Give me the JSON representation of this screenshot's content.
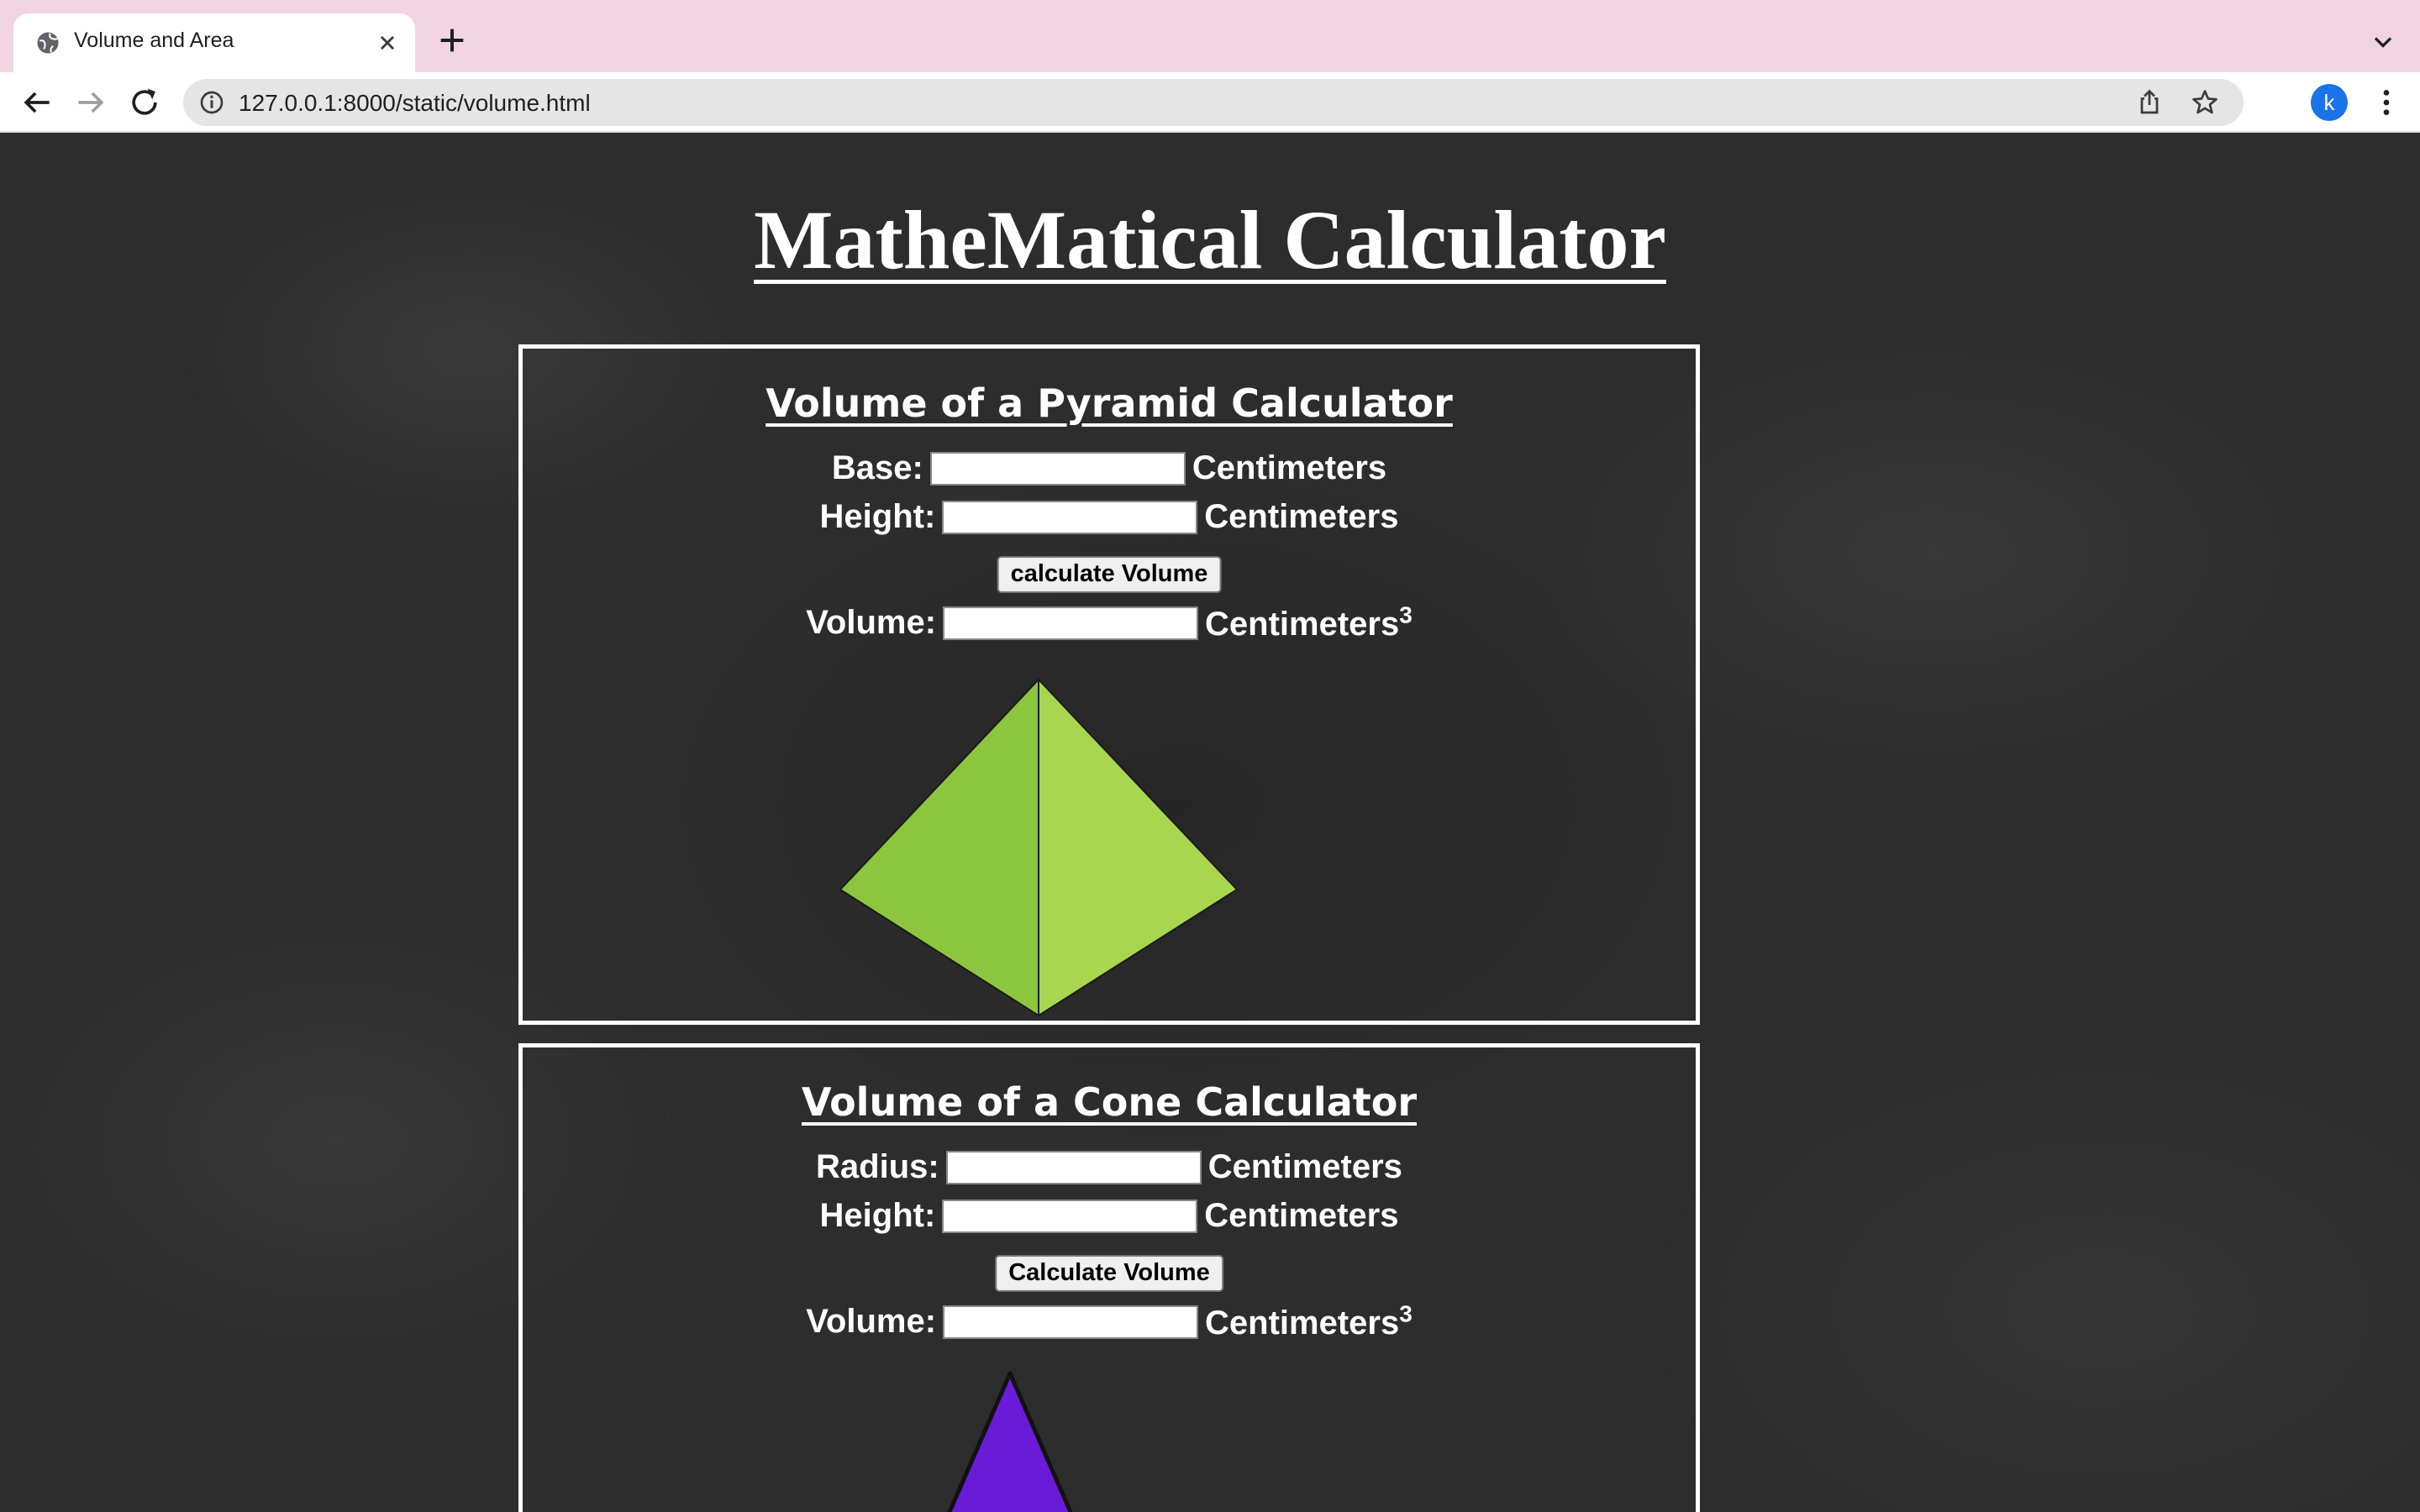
{
  "browser": {
    "tab_title": "Volume and Area",
    "url": "127.0.0.1:8000/static/volume.html",
    "avatar_letter": "k"
  },
  "page": {
    "title": "MatheMatical Calculator",
    "pyramid": {
      "title": "Volume of a Pyramid Calculator",
      "base_label": "Base:",
      "height_label": "Height:",
      "unit": "Centimeters",
      "button_label": "calculate Volume",
      "volume_label": "Volume:",
      "volume_unit": "Centimeters",
      "volume_exponent": "3",
      "base_value": "",
      "height_value": "",
      "volume_value": "",
      "colors": {
        "left_face": "#8cc63f",
        "right_face": "#a8d64f"
      }
    },
    "cone": {
      "title": "Volume of a Cone Calculator",
      "radius_label": "Radius:",
      "height_label": "Height:",
      "unit": "Centimeters",
      "button_label": "Calculate Volume",
      "volume_label": "Volume:",
      "volume_unit": "Centimeters",
      "volume_exponent": "3",
      "radius_value": "",
      "height_value": "",
      "volume_value": "",
      "colors": {
        "fill": "#6a1bd8"
      }
    }
  }
}
